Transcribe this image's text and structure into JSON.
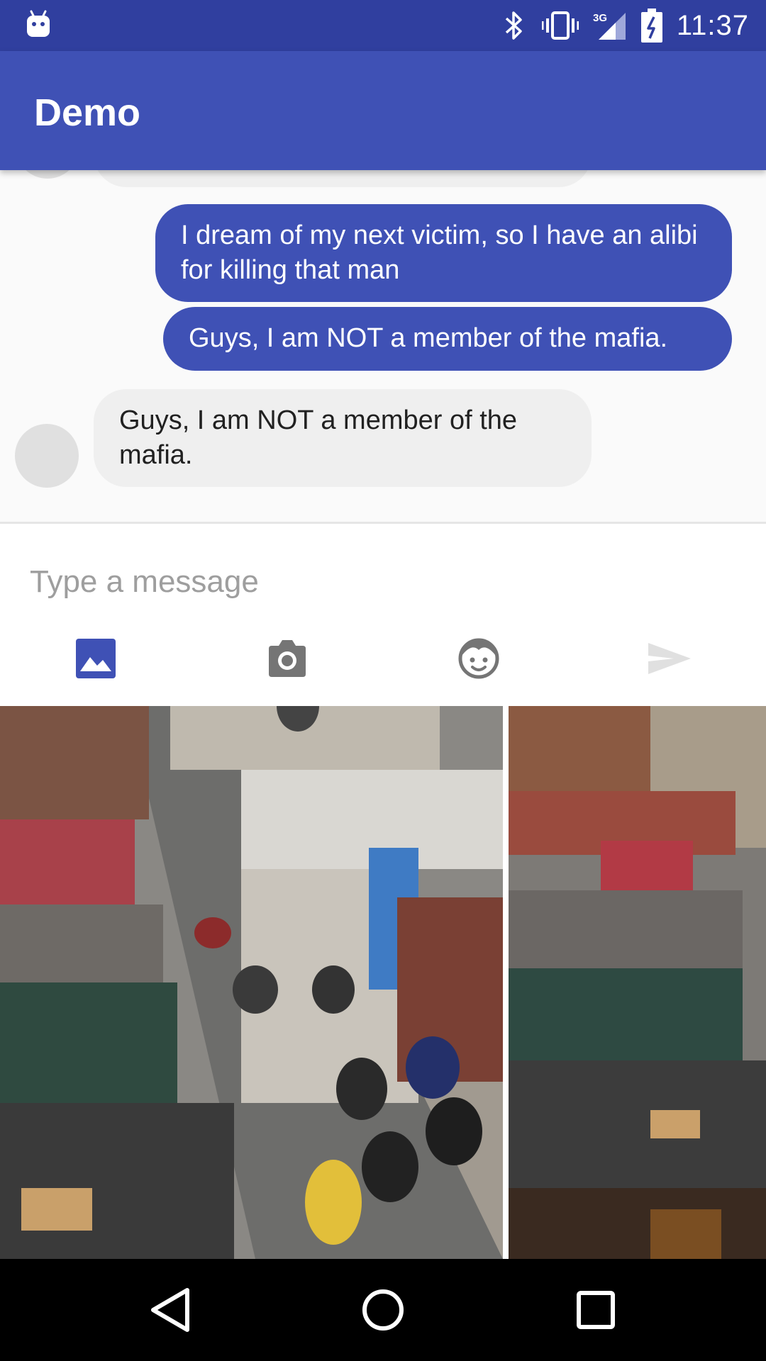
{
  "status_bar": {
    "time": "11:37",
    "network": "3G",
    "icons": [
      "android-icon",
      "bluetooth-icon",
      "vibrate-icon",
      "signal-icon",
      "battery-icon"
    ]
  },
  "app_bar": {
    "title": "Demo"
  },
  "messages": [
    {
      "direction": "outgoing",
      "text": "I dream of my next victim, so I have an alibi for killing that man"
    },
    {
      "direction": "outgoing",
      "text": "Guys, I am NOT a member of the mafia."
    },
    {
      "direction": "incoming",
      "text": "Guys, I am NOT a member of the mafia."
    }
  ],
  "composer": {
    "placeholder": "Type a message",
    "value": "",
    "tools": [
      "gallery-icon",
      "camera-icon",
      "emoji-icon",
      "send-icon"
    ],
    "active_tool": "gallery-icon"
  },
  "colors": {
    "status_bar": "#303f9f",
    "primary": "#3f51b5",
    "incoming_bubble": "#efefef",
    "icon_inactive": "#757575",
    "send_disabled": "#e0e0e0"
  },
  "nav_bar": {
    "buttons": [
      "back-icon",
      "home-icon",
      "recents-icon"
    ]
  }
}
